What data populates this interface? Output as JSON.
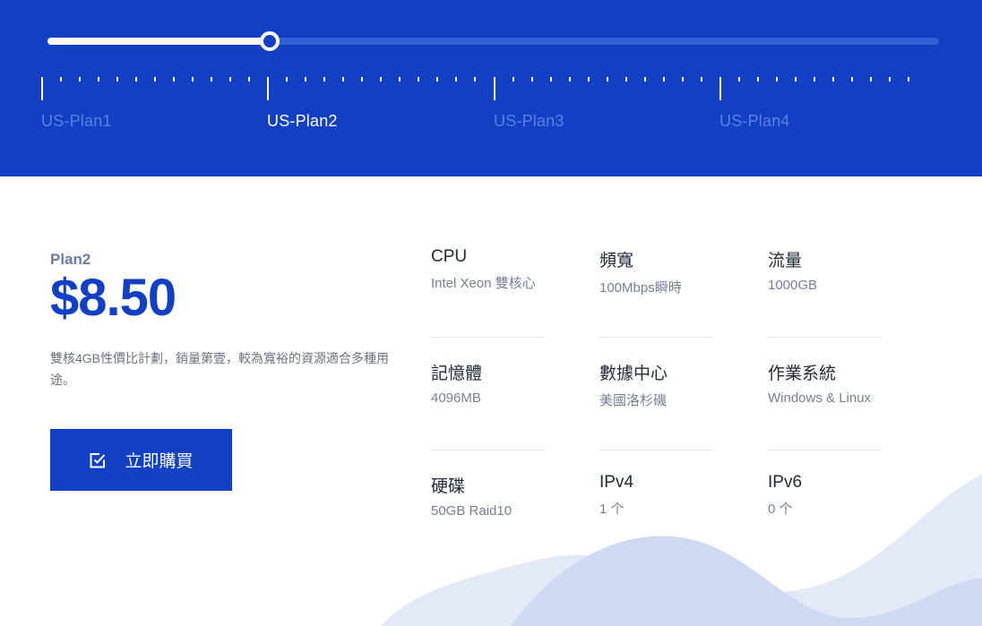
{
  "slider": {
    "value_index": 1,
    "plans": [
      "US-Plan1",
      "US-Plan2",
      "US-Plan3",
      "US-Plan4"
    ]
  },
  "plan": {
    "name": "Plan2",
    "price": "$8.50",
    "description": "雙核4GB性價比計劃，銷量第壹，較為寬裕的資源適合多種用途。",
    "buy_label": "立即購買"
  },
  "specs": [
    {
      "label": "CPU",
      "value": "Intel Xeon 雙核心"
    },
    {
      "label": "頻寬",
      "value": "100Mbps瞬時"
    },
    {
      "label": "流量",
      "value": "1000GB"
    },
    {
      "label": "記憶體",
      "value": "4096MB"
    },
    {
      "label": "數據中心",
      "value": "美國洛杉磯"
    },
    {
      "label": "作業系統",
      "value": "Windows & Linux"
    },
    {
      "label": "硬碟",
      "value": "50GB Raid10"
    },
    {
      "label": "IPv4",
      "value": "1 个"
    },
    {
      "label": "IPv6",
      "value": "0 个"
    }
  ],
  "colors": {
    "brand": "#1240c4",
    "track": "#3260d7",
    "inactive_label": "#5c80e0",
    "wave_light": "#e4e9f7",
    "wave_mid": "#cfdaf2"
  },
  "icons": {
    "buy": "checkbox-icon"
  }
}
